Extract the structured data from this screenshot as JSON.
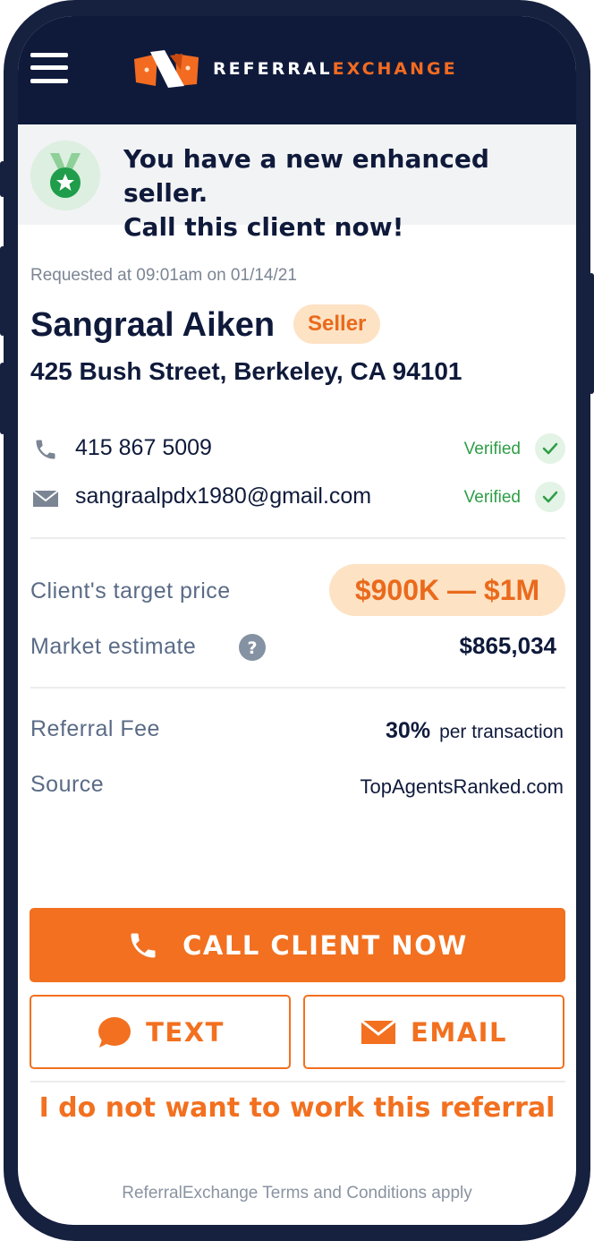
{
  "brand": {
    "name_part1": "REFERRAL",
    "name_part2": "EXCHANGE",
    "primary_color": "#f2701f",
    "navy_color": "#0f1a3b"
  },
  "banner": {
    "line1": "You have a new enhanced seller.",
    "line2": "Call this client now!",
    "icon": "medal-star-icon"
  },
  "client": {
    "requested": "Requested at 09:01am on 01/14/21",
    "name": "Sangraal Aiken",
    "type_badge": "Seller",
    "address": "425 Bush Street, Berkeley, CA 94101"
  },
  "contacts": [
    {
      "icon": "phone-icon",
      "value": "415 867 5009",
      "status": "Verified"
    },
    {
      "icon": "mail-icon",
      "value": "sangraalpdx1980@gmail.com",
      "status": "Verified"
    }
  ],
  "pricing": {
    "target_label": "Client's target price",
    "target_value": "$900K — $1M",
    "estimate_label": "Market estimate",
    "estimate_value": "$865,034"
  },
  "referral": {
    "fee_label": "Referral Fee",
    "fee_percent": "30%",
    "fee_suffix": "per transaction",
    "source_label": "Source",
    "source_value": "TopAgentsRanked.com"
  },
  "actions": {
    "call": "CALL CLIENT NOW",
    "text": "TEXT",
    "email": "EMAIL",
    "decline": "I do not want to work this referral"
  },
  "footer": {
    "terms": "ReferralExchange Terms and Conditions apply"
  }
}
